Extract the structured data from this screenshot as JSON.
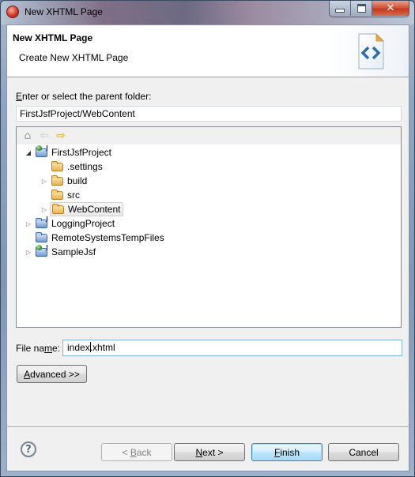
{
  "window": {
    "title": "New XHTML Page",
    "controls": {
      "minimize": "minimize",
      "maximize": "maximize",
      "close": "✕"
    }
  },
  "header": {
    "title": "New XHTML Page",
    "description": "Create New XHTML Page",
    "banner_icon": "xhtml-file-icon"
  },
  "parent_folder": {
    "label_prefix": "",
    "label_mnemonic": "E",
    "label_rest": "nter or select the parent folder:",
    "value": "FirstJsfProject/WebContent"
  },
  "tree": {
    "toolbar": [
      {
        "name": "home",
        "glyph": "⌂"
      },
      {
        "name": "back",
        "glyph": "⇦"
      },
      {
        "name": "forward",
        "glyph": "⇨"
      }
    ],
    "items": [
      {
        "label": "FirstJsfProject",
        "type": "project",
        "level": 0,
        "twisty": "expanded"
      },
      {
        "label": ".settings",
        "type": "folder",
        "level": 1,
        "twisty": "none"
      },
      {
        "label": "build",
        "type": "folder",
        "level": 1,
        "twisty": "collapsed"
      },
      {
        "label": "src",
        "type": "folder",
        "level": 1,
        "twisty": "none"
      },
      {
        "label": "WebContent",
        "type": "folder",
        "level": 1,
        "twisty": "collapsed",
        "selected": true
      },
      {
        "label": "LoggingProject",
        "type": "project-plain",
        "level": 0,
        "twisty": "collapsed"
      },
      {
        "label": "RemoteSystemsTempFiles",
        "type": "folder-plain",
        "level": 0,
        "twisty": "none"
      },
      {
        "label": "SampleJsf",
        "type": "project",
        "level": 0,
        "twisty": "collapsed"
      }
    ]
  },
  "file_name": {
    "label_pre": "File na",
    "label_mnemonic": "m",
    "label_post": "e:",
    "value_before_caret": "index",
    "value_after_caret": ".xhtml"
  },
  "advanced_button": {
    "mnemonic": "A",
    "rest": "dvanced >>"
  },
  "footer": {
    "help": "?",
    "back": {
      "pre": "< ",
      "mnemonic": "B",
      "rest": "ack",
      "enabled": false
    },
    "next": {
      "pre": "",
      "mnemonic": "N",
      "rest": "ext >",
      "enabled": true
    },
    "finish": {
      "pre": "",
      "mnemonic": "F",
      "rest": "inish",
      "enabled": true,
      "default": true
    },
    "cancel": {
      "label": "Cancel",
      "enabled": true
    }
  }
}
